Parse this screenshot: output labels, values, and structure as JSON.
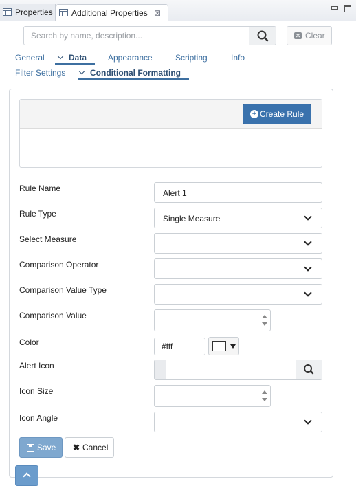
{
  "view_tabs": [
    {
      "label": "Properties"
    },
    {
      "label": "Additional Properties",
      "close": "⊠"
    }
  ],
  "search": {
    "placeholder": "Search by name, description...",
    "clear_label": "Clear"
  },
  "tabs": {
    "general": "General",
    "data": "Data",
    "appearance": "Appearance",
    "scripting": "Scripting",
    "info": "Info",
    "filter_settings": "Filter Settings",
    "conditional_formatting": "Conditional Formatting"
  },
  "rules": {
    "create_label": "Create Rule"
  },
  "form": {
    "rule_name": {
      "label": "Rule Name",
      "value": "Alert 1"
    },
    "rule_type": {
      "label": "Rule Type",
      "value": "Single Measure"
    },
    "select_measure": {
      "label": "Select Measure",
      "value": ""
    },
    "comparison_operator": {
      "label": "Comparison Operator",
      "value": ""
    },
    "comparison_value_type": {
      "label": "Comparison Value Type",
      "value": ""
    },
    "comparison_value": {
      "label": "Comparison Value",
      "value": ""
    },
    "color": {
      "label": "Color",
      "value": "#fff"
    },
    "alert_icon": {
      "label": "Alert Icon",
      "value": ""
    },
    "icon_size": {
      "label": "Icon Size",
      "value": ""
    },
    "icon_angle": {
      "label": "Icon Angle",
      "value": ""
    }
  },
  "actions": {
    "save": "Save",
    "cancel": "Cancel"
  },
  "colors": {
    "accent": "#3a72ad",
    "link": "#3d6fa0",
    "save_disabled": "#7fa8cf"
  },
  "icons": [
    "table-icon",
    "close-icon",
    "minimize-icon",
    "maximize-icon",
    "search-icon",
    "clear-icon",
    "chevron-down-icon",
    "plus-circle-icon",
    "save-icon",
    "times-icon",
    "chevron-up-icon"
  ]
}
